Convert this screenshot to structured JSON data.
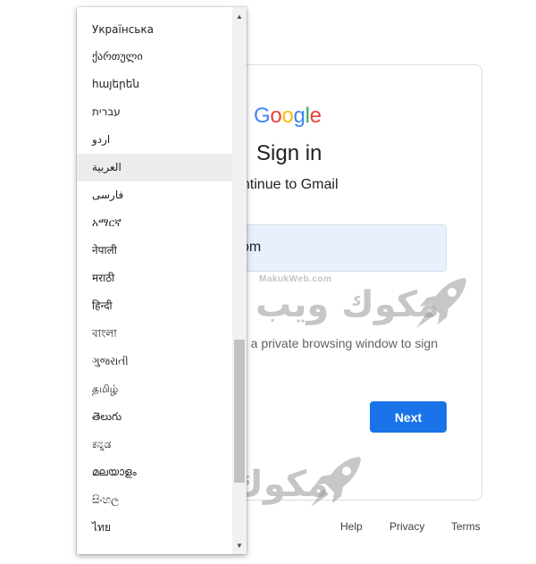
{
  "signin": {
    "logo_letters": [
      "G",
      "o",
      "o",
      "g",
      "l",
      "e"
    ],
    "title": "Sign in",
    "subtitle": "ontinue to Gmail",
    "email_value": "om",
    "hint": "se a private browsing window to sign",
    "next_label": "Next"
  },
  "footer": {
    "help": "Help",
    "privacy": "Privacy",
    "terms": "Terms"
  },
  "watermark": {
    "site": "MakukWeb.com",
    "arabic": "مكوك ويب"
  },
  "language_menu": {
    "items": [
      "Українська",
      "ქართული",
      "հայերեն",
      "עברית",
      "اردو",
      "العربية",
      "فارسی",
      "አማርኛ",
      "नेपाली",
      "मराठी",
      "हिन्दी",
      "বাংলা",
      "ગુજરાતી",
      "தமிழ்",
      "తెలుగు",
      "ಕನ್ನಡ",
      "മലയാളം",
      "සිංහල",
      "ไทย"
    ],
    "highlighted": "العربية",
    "scroll_up": "▲",
    "scroll_down": "▼"
  },
  "colors": {
    "google_blue": "#4285F4",
    "google_red": "#EA4335",
    "google_yellow": "#FBBC05",
    "google_green": "#34A853",
    "button_blue": "#1a73e8",
    "email_bg": "#e8f0fe",
    "highlight": "#ececec"
  }
}
